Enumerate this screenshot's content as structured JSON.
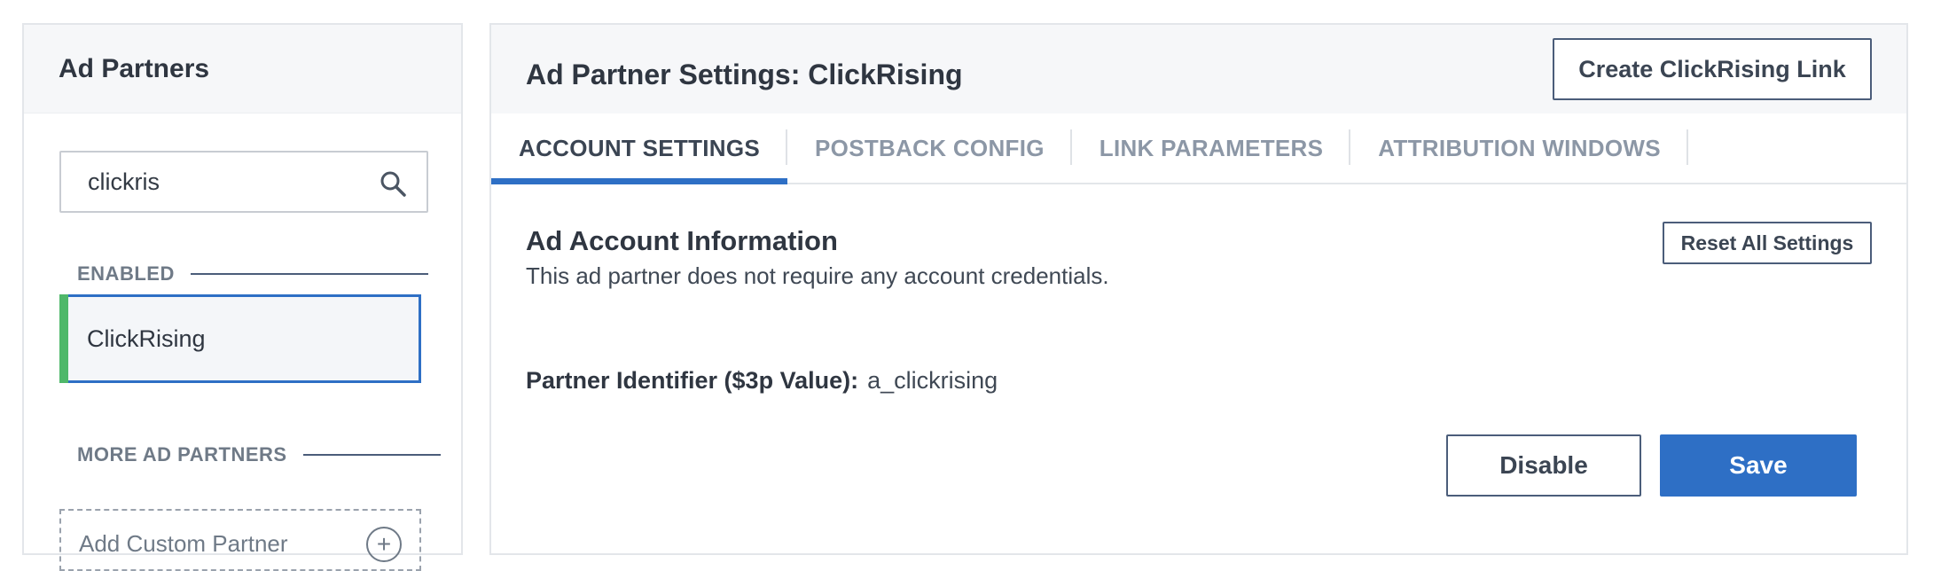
{
  "sidebar": {
    "title": "Ad Partners",
    "search": {
      "value": "clickris",
      "placeholder": ""
    },
    "enabled_label": "ENABLED",
    "enabled_items": [
      {
        "label": "ClickRising",
        "status_color": "#4fb86a",
        "selected": true
      }
    ],
    "more_label": "MORE AD PARTNERS",
    "add_custom_label": "Add Custom Partner"
  },
  "main": {
    "title": "Ad Partner Settings: ClickRising",
    "create_link_label": "Create ClickRising Link",
    "tabs": [
      {
        "label": "ACCOUNT SETTINGS",
        "active": true
      },
      {
        "label": "POSTBACK CONFIG",
        "active": false
      },
      {
        "label": "LINK PARAMETERS",
        "active": false
      },
      {
        "label": "ATTRIBUTION WINDOWS",
        "active": false
      }
    ],
    "section_title": "Ad Account Information",
    "section_desc": "This ad partner does not require any account credentials.",
    "reset_label": "Reset All Settings",
    "identifier_label": "Partner Identifier ($3p Value):",
    "identifier_value": "a_clickrising",
    "disable_label": "Disable",
    "save_label": "Save"
  },
  "colors": {
    "accent": "#2e6fc5",
    "enabled_status": "#4fb86a",
    "header_bg": "#f6f7f9"
  },
  "icons": {
    "search": "search-icon",
    "add": "plus-circle-icon"
  }
}
